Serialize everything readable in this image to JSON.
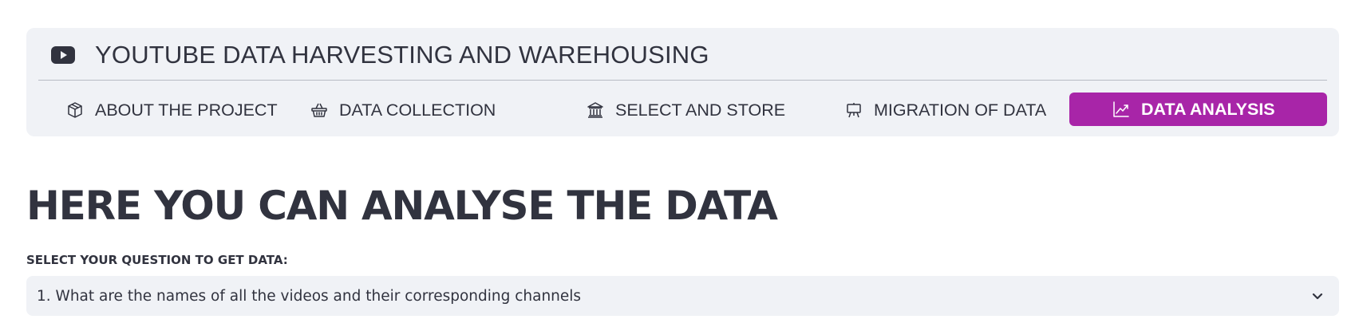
{
  "app": {
    "title": "YOUTUBE DATA HARVESTING AND WAREHOUSING",
    "icon": "youtube-icon"
  },
  "nav": {
    "items": [
      {
        "label": "ABOUT THE PROJECT",
        "icon": "box-icon",
        "active": false
      },
      {
        "label": "DATA COLLECTION",
        "icon": "basket-icon",
        "active": false
      },
      {
        "label": "SELECT AND STORE",
        "icon": "bank-icon",
        "active": false
      },
      {
        "label": "MIGRATION OF DATA",
        "icon": "easel-icon",
        "active": false
      },
      {
        "label": "DATA ANALYSIS",
        "icon": "graph-up-icon",
        "active": true
      }
    ],
    "active_color": "#a825a8"
  },
  "main": {
    "heading": "HERE YOU CAN ANALYSE THE DATA",
    "select": {
      "label": "SELECT YOUR QUESTION TO GET DATA:",
      "value": "1. What are the names of all the videos and their corresponding channels"
    }
  }
}
